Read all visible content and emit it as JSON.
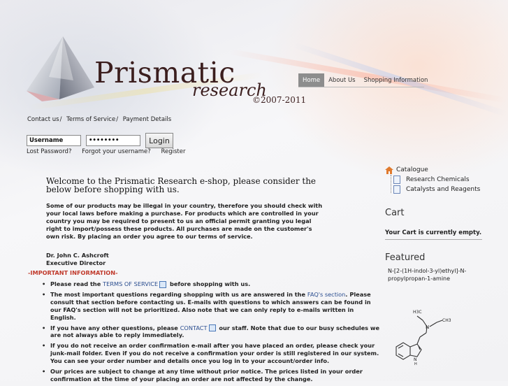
{
  "brand": {
    "name": "Prismatic",
    "sub": "research",
    "copyright": "©2007-2011"
  },
  "nav": {
    "items": [
      {
        "label": "Home",
        "active": true
      },
      {
        "label": "About Us",
        "active": false
      },
      {
        "label": "Shopping Information",
        "active": false
      }
    ]
  },
  "toplinks": {
    "contact": "Contact us",
    "terms": "Terms of Service",
    "payment": "Payment Details",
    "separator": "/"
  },
  "login": {
    "username_value": "Username",
    "password_value": "••••••••",
    "button": "Login",
    "lost_password": "Lost Password?",
    "forgot_username": "Forgot your username?",
    "register": "Register"
  },
  "main": {
    "title": "Welcome to the Prismatic Research e-shop, please consider the below before shopping with us.",
    "intro": "Some of our products may be illegal in your country, therefore you should check with your local laws before making a purchase. For products which are controlled in your country you may be required to present to us an official permit granting you legal right to import/possess these products. All purchases are made on the customer's own risk. By placing an order you agree to our terms of service.",
    "signature_name": "Dr. John C. Ashcroft",
    "signature_title": "Executive Director",
    "important": "-IMPORTANT INFORMATION-",
    "b1_pre": "Please read the ",
    "b1_link": "TERMS OF SERVICE",
    "b1_post": " before shopping with us.",
    "b2_pre": "The most important questions regarding shopping with us are answered in the ",
    "b2_link": "FAQ's section",
    "b2_post": ". Please consult that section before contacting us. E-mails with questions to which answers can be found in our FAQ's section will not be prioritized. Also note that we can only reply to e-mails written in English.",
    "b3_pre": "If you have any other questions, please ",
    "b3_link": "CONTACT",
    "b3_post": " our staff. Note that due to our busy schedules we are not always able to reply immediately.",
    "b4": "If you do not receive an order confirmation e-mail after you have placed an order, please check your junk-mail folder. Even if you do not receive a confirmation your order is still registered in our system. You can see your order number and details once you log in to your account/order info.",
    "b5": "Our prices are subject to change at any time without prior notice. The prices listed in your order confirmation at the time of your placing an order are not affected by the change."
  },
  "sidebar": {
    "catalogue": "Catalogue",
    "items": [
      "Research Chemicals",
      "Catalysts and Reagents"
    ],
    "cart_heading": "Cart",
    "cart_text": "Your Cart is currently empty.",
    "featured_heading": "Featured",
    "featured_text": "N-[2-(1H-indol-3-yl)ethyl]-N-propylpropan-1-amine",
    "molecule_labels": {
      "h3c": "H3C",
      "ch3": "CH3",
      "n": "N",
      "nh": "N",
      "h": "H"
    }
  }
}
